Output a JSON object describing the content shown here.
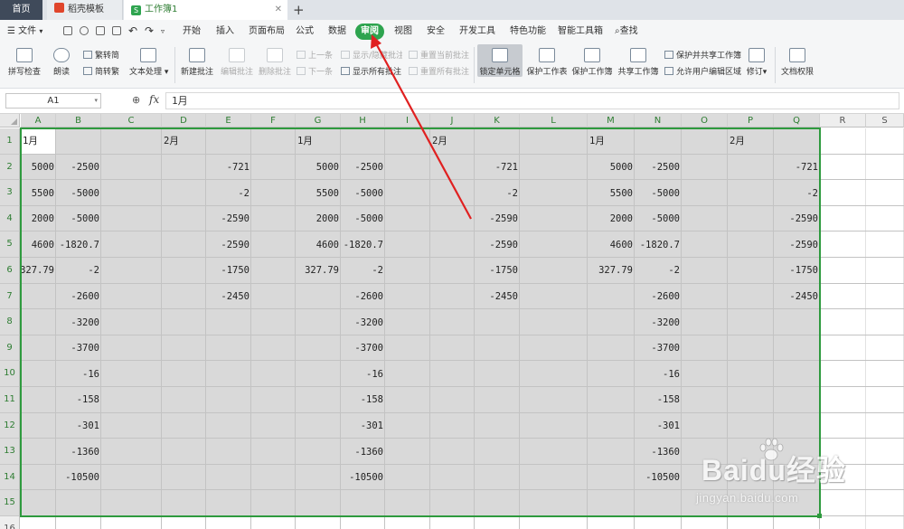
{
  "tabs": {
    "home": "首页",
    "template": "稻壳模板",
    "document": "工作簿1",
    "new_tab": "+"
  },
  "menu": {
    "file": "文件",
    "items": [
      "开始",
      "插入",
      "页面布局",
      "公式",
      "数据",
      "审阅",
      "视图",
      "安全",
      "开发工具",
      "特色功能",
      "智能工具箱"
    ],
    "active": "审阅",
    "search": "查找"
  },
  "ribbon": {
    "spell_check": "拼写检查",
    "read_aloud": "朗读",
    "trad_to_simp": "繁转简",
    "simp_to_trad": "简转繁",
    "text_processing": "文本处理",
    "new_comment": "新建批注",
    "edit_comment": "编辑批注",
    "delete_comment": "删除批注",
    "prev": "上一条",
    "next": "下一条",
    "show_hide_comment": "显示/隐藏批注",
    "show_all_comments": "显示所有批注",
    "reset_current_comment": "重置当前批注",
    "reset_all_comments": "重置所有批注",
    "lock_cell": "锁定单元格",
    "protect_sheet": "保护工作表",
    "protect_workbook": "保护工作簿",
    "share_workbook": "共享工作簿",
    "protect_share": "保护并共享工作簿",
    "allow_edit_ranges": "允许用户编辑区域",
    "track_changes": "修订",
    "doc_permissions": "文档权限"
  },
  "formula_bar": {
    "name_box": "A1",
    "fx": "fx",
    "value": "1月"
  },
  "columns": [
    "A",
    "B",
    "C",
    "D",
    "E",
    "F",
    "G",
    "H",
    "I",
    "J",
    "K",
    "L",
    "M",
    "N",
    "O",
    "P",
    "Q",
    "R",
    "S"
  ],
  "rows": [
    "1",
    "2",
    "3",
    "4",
    "5",
    "6",
    "7",
    "8",
    "9",
    "10",
    "11",
    "12",
    "13",
    "14",
    "15",
    "16"
  ],
  "cells": {
    "A1": "1月",
    "D1": "2月",
    "G1": "1月",
    "J1": "2月",
    "M1": "1月",
    "P1": "2月",
    "A2": "5000",
    "A3": "5500",
    "A4": "2000",
    "A5": "4600",
    "A6": "327.79",
    "B2": "-2500",
    "B3": "-5000",
    "B4": "-5000",
    "B5": "-1820.7",
    "B6": "-2",
    "B7": "-2600",
    "B8": "-3200",
    "B9": "-3700",
    "B10": "-16",
    "B11": "-158",
    "B12": "-301",
    "B13": "-1360",
    "B14": "-10500",
    "E2": "-721",
    "E3": "-2",
    "E4": "-2590",
    "E5": "-2590",
    "E6": "-1750",
    "E7": "-2450",
    "G2": "5000",
    "G3": "5500",
    "G4": "2000",
    "G5": "4600",
    "G6": "327.79",
    "H2": "-2500",
    "H3": "-5000",
    "H4": "-5000",
    "H5": "-1820.7",
    "H6": "-2",
    "H7": "-2600",
    "H8": "-3200",
    "H9": "-3700",
    "H10": "-16",
    "H11": "-158",
    "H12": "-301",
    "H13": "-1360",
    "H14": "-10500",
    "K2": "-721",
    "K3": "-2",
    "K4": "-2590",
    "K5": "-2590",
    "K6": "-1750",
    "K7": "-2450",
    "M2": "5000",
    "M3": "5500",
    "M4": "2000",
    "M5": "4600",
    "M6": "327.79",
    "N2": "-2500",
    "N3": "-5000",
    "N4": "-5000",
    "N5": "-1820.7",
    "N6": "-2",
    "N7": "-2600",
    "N8": "-3200",
    "N9": "-3700",
    "N10": "-16",
    "N11": "-158",
    "N12": "-301",
    "N13": "-1360",
    "N14": "-10500",
    "Q2": "-721",
    "Q3": "-2",
    "Q4": "-2590",
    "Q5": "-2590",
    "Q6": "-1750",
    "Q7": "-2450"
  },
  "colors": {
    "accent": "#2ea44f",
    "selection_border": "#2e9a3e",
    "selection_fill": "#d9d9d9",
    "arrow": "#e02020"
  },
  "watermark": {
    "brand": "Baidu经验",
    "url": "jingyan.baidu.com"
  }
}
